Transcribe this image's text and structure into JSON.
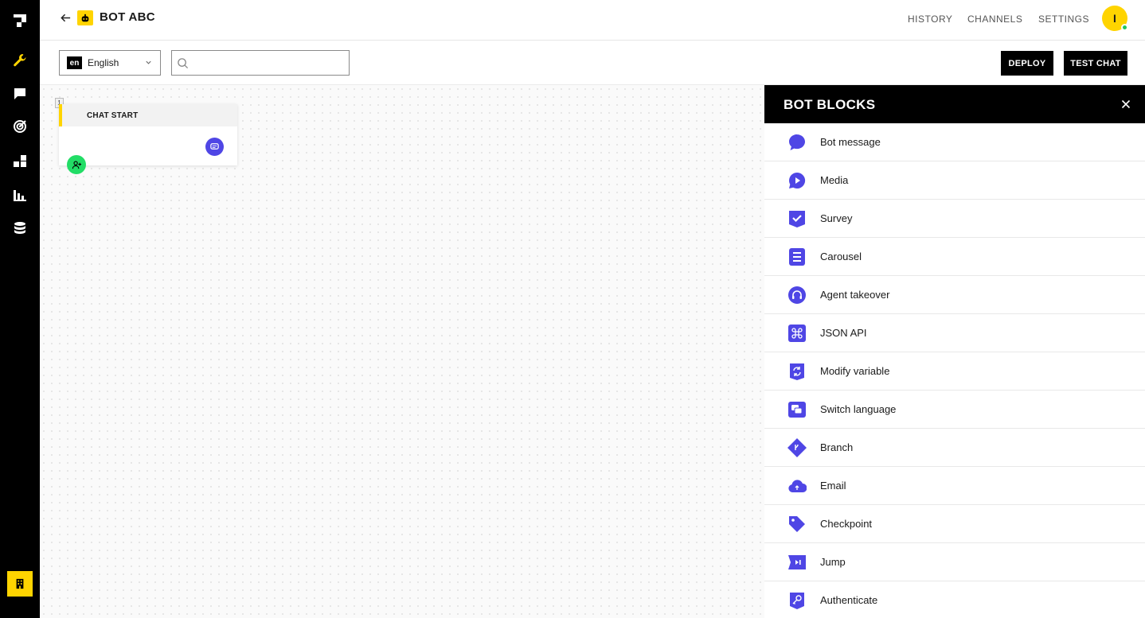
{
  "header": {
    "title": "BOT ABC",
    "nav": [
      "HISTORY",
      "CHANNELS",
      "SETTINGS"
    ],
    "avatar_initial": "I"
  },
  "toolbar": {
    "language_code": "en",
    "language_name": "English",
    "search_value": "",
    "deploy_label": "DEPLOY",
    "test_chat_label": "TEST CHAT"
  },
  "canvas": {
    "node_number": "1",
    "node_title": "CHAT START"
  },
  "panel": {
    "title": "BOT BLOCKS",
    "items": [
      {
        "label": "Bot message",
        "icon": "chat-bubble-icon"
      },
      {
        "label": "Media",
        "icon": "play-icon"
      },
      {
        "label": "Survey",
        "icon": "checkbox-icon"
      },
      {
        "label": "Carousel",
        "icon": "list-icon"
      },
      {
        "label": "Agent takeover",
        "icon": "headset-icon"
      },
      {
        "label": "JSON API",
        "icon": "command-icon"
      },
      {
        "label": "Modify variable",
        "icon": "refresh-icon"
      },
      {
        "label": "Switch language",
        "icon": "translate-icon"
      },
      {
        "label": "Branch",
        "icon": "branch-icon"
      },
      {
        "label": "Email",
        "icon": "cloud-upload-icon"
      },
      {
        "label": "Checkpoint",
        "icon": "tag-icon"
      },
      {
        "label": "Jump",
        "icon": "skip-icon"
      },
      {
        "label": "Authenticate",
        "icon": "key-icon"
      }
    ]
  },
  "colors": {
    "accent": "#ffd400",
    "block_icon": "#4f46e5",
    "dark": "#000000",
    "online": "#22c55e"
  }
}
